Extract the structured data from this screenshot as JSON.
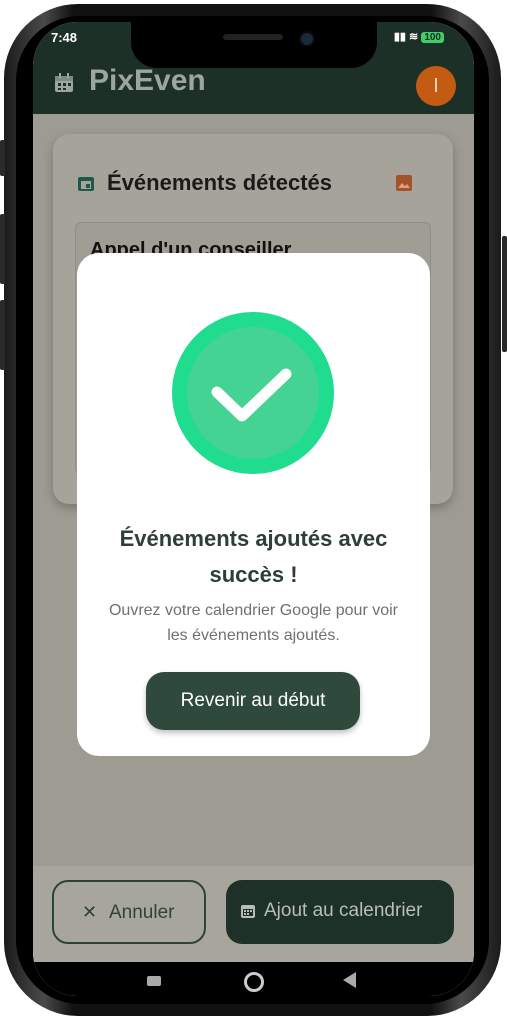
{
  "status_bar": {
    "time": "7:48",
    "battery": "100"
  },
  "app_bar": {
    "title": "PixEven",
    "avatar_initial": "I"
  },
  "card": {
    "title": "Événements détectés",
    "event_title": "Appel d'un conseiller"
  },
  "dialog": {
    "title": "Événements ajoutés avec succès !",
    "message": "Ouvrez votre calendrier Google pour voir les événements ajoutés.",
    "button_label": "Revenir au début",
    "icon": "check-circle-icon"
  },
  "bottom_bar": {
    "cancel_label": "Annuler",
    "add_label": "Ajout au calendrier"
  },
  "colors": {
    "primary_dark": "#1d3027",
    "success_green": "#2bd68a",
    "avatar": "#c45b12"
  }
}
